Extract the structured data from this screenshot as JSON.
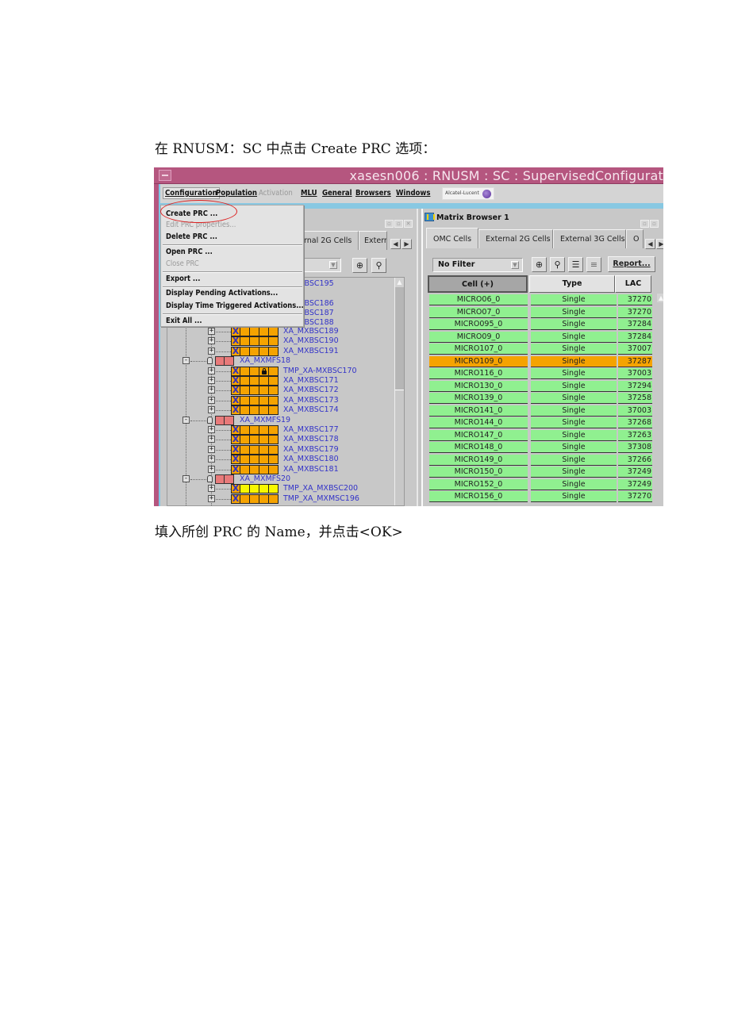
{
  "document": {
    "instruction_1": "在 RNUSM：SC 中点击 Create PRC 选项：",
    "instruction_2": "填入所创 PRC 的 Name，并点击<OK>"
  },
  "window": {
    "title": "xasesn006 : RNUSM : SC : SupervisedConfigurat",
    "title_bar_color": "#b5567f"
  },
  "menubar": {
    "items": [
      {
        "label": "Configuration",
        "state": "active"
      },
      {
        "label": "Population",
        "state": "enabled"
      },
      {
        "label": "Activation",
        "state": "disabled"
      },
      {
        "label": "MLU",
        "state": "enabled"
      },
      {
        "label": "General",
        "state": "enabled"
      },
      {
        "label": "Browsers",
        "state": "enabled"
      },
      {
        "label": "Windows",
        "state": "enabled"
      }
    ],
    "logo_text": "Alcatel-Lucent"
  },
  "configuration_menu": {
    "items": [
      {
        "label": "Create PRC ...",
        "enabled": true,
        "highlighted_by_annotation": true
      },
      {
        "label": "Edit PRC properties...",
        "enabled": false
      },
      {
        "label": "Delete PRC ...",
        "enabled": true
      },
      {
        "label": "Open PRC ...",
        "enabled": true
      },
      {
        "label": "Close PRC",
        "enabled": false
      },
      {
        "label": "Export ...",
        "enabled": true
      },
      {
        "label": "Display Pending Activations...",
        "enabled": true
      },
      {
        "label": "Display Time Triggered Activations...",
        "enabled": true
      },
      {
        "label": "Exit All ...",
        "enabled": true
      }
    ]
  },
  "left_panel": {
    "tabs": [
      "rnal 2G Cells",
      "Exterr"
    ],
    "tree": {
      "partial_labels": [
        "XBSC195",
        "XBSC186",
        "XBSC187",
        "XBSC188"
      ],
      "nodes": [
        {
          "label": "XA_MXBSC189",
          "type": "bsc",
          "cells": "orange"
        },
        {
          "label": "XA_MXBSC190",
          "type": "bsc",
          "cells": "orange"
        },
        {
          "label": "XA_MXBSC191",
          "type": "bsc",
          "cells": "orange"
        },
        {
          "label": "XA_MXMFS18",
          "type": "mfs"
        },
        {
          "label": "TMP_XA-MXBSC170",
          "type": "bsc",
          "cells": "orange",
          "locked": true
        },
        {
          "label": "XA_MXBSC171",
          "type": "bsc",
          "cells": "orange"
        },
        {
          "label": "XA_MXBSC172",
          "type": "bsc",
          "cells": "orange"
        },
        {
          "label": "XA_MXBSC173",
          "type": "bsc",
          "cells": "orange"
        },
        {
          "label": "XA_MXBSC174",
          "type": "bsc",
          "cells": "orange"
        },
        {
          "label": "XA_MXMFS19",
          "type": "mfs"
        },
        {
          "label": "XA_MXBSC177",
          "type": "bsc",
          "cells": "orange"
        },
        {
          "label": "XA_MXBSC178",
          "type": "bsc",
          "cells": "orange"
        },
        {
          "label": "XA_MXBSC179",
          "type": "bsc",
          "cells": "orange"
        },
        {
          "label": "XA_MXBSC180",
          "type": "bsc",
          "cells": "orange"
        },
        {
          "label": "XA_MXBSC181",
          "type": "bsc",
          "cells": "orange"
        },
        {
          "label": "XA_MXMFS20",
          "type": "mfs"
        },
        {
          "label": "TMP_XA_MXBSC200",
          "type": "bsc",
          "cells": "yellow"
        },
        {
          "label": "TMP_XA_MXMSC196",
          "type": "bsc",
          "cells": "orange"
        }
      ]
    }
  },
  "matrix_browser": {
    "title": "Matrix Browser 1",
    "tabs": [
      "OMC Cells",
      "External 2G Cells",
      "External 3G Cells",
      "O"
    ],
    "active_tab": "OMC Cells",
    "filter": "No Filter",
    "report_button": "Report...",
    "columns": [
      "Cell (+)",
      "Type",
      "LAC"
    ],
    "rows": [
      {
        "cell": "MICRO06_0",
        "type": "Single",
        "lac": "37270"
      },
      {
        "cell": "MICRO07_0",
        "type": "Single",
        "lac": "37270"
      },
      {
        "cell": "MICRO095_0",
        "type": "Single",
        "lac": "37284"
      },
      {
        "cell": "MICRO09_0",
        "type": "Single",
        "lac": "37284"
      },
      {
        "cell": "MICRO107_0",
        "type": "Single",
        "lac": "37007"
      },
      {
        "cell": "MICRO109_0",
        "type": "Single",
        "lac": "37287",
        "highlighted": true
      },
      {
        "cell": "MICRO116_0",
        "type": "Single",
        "lac": "37003"
      },
      {
        "cell": "MICRO130_0",
        "type": "Single",
        "lac": "37294"
      },
      {
        "cell": "MICRO139_0",
        "type": "Single",
        "lac": "37258"
      },
      {
        "cell": "MICRO141_0",
        "type": "Single",
        "lac": "37003"
      },
      {
        "cell": "MICRO144_0",
        "type": "Single",
        "lac": "37268"
      },
      {
        "cell": "MICRO147_0",
        "type": "Single",
        "lac": "37263"
      },
      {
        "cell": "MICRO148_0",
        "type": "Single",
        "lac": "37308"
      },
      {
        "cell": "MICRO149_0",
        "type": "Single",
        "lac": "37266"
      },
      {
        "cell": "MICRO150_0",
        "type": "Single",
        "lac": "37249"
      },
      {
        "cell": "MICRO152_0",
        "type": "Single",
        "lac": "37249"
      },
      {
        "cell": "MICRO156_0",
        "type": "Single",
        "lac": "37270"
      }
    ],
    "row_color": "#90f090",
    "highlight_color": "#f5a300"
  },
  "icons": {
    "zoom": "zoom-magnifier-icon",
    "find": "binoculars-icon",
    "list_bold": "list-bold-icon",
    "list_thin": "list-thin-icon"
  }
}
